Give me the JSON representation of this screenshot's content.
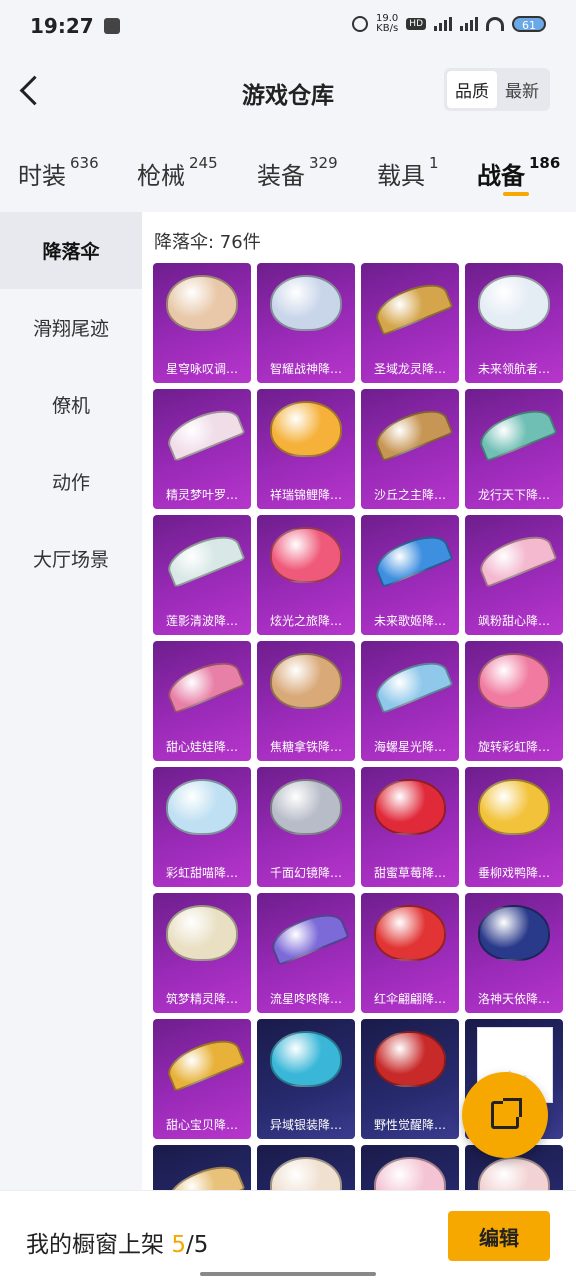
{
  "status_bar": {
    "time": "19:27",
    "speed_value": "19.0",
    "speed_unit": "KB/s",
    "battery": "61"
  },
  "header": {
    "title": "游戏仓库",
    "sort_options": [
      "品质",
      "最新"
    ],
    "active_sort": "品质"
  },
  "tabs": [
    {
      "label": "时装",
      "count": "636",
      "active": false
    },
    {
      "label": "枪械",
      "count": "245",
      "active": false
    },
    {
      "label": "装备",
      "count": "329",
      "active": false
    },
    {
      "label": "载具",
      "count": "1",
      "active": false
    },
    {
      "label": "战备",
      "count": "186",
      "active": true
    }
  ],
  "sidebar": {
    "items": [
      {
        "label": "降落伞",
        "active": true
      },
      {
        "label": "滑翔尾迹",
        "active": false
      },
      {
        "label": "僚机",
        "active": false
      },
      {
        "label": "动作",
        "active": false
      },
      {
        "label": "大厅场景",
        "active": false
      }
    ]
  },
  "content": {
    "count_label": "降落伞: 76件",
    "items": [
      {
        "name": "星穹咏叹调…",
        "shape": "dome",
        "color": "#e8c8a8"
      },
      {
        "name": "智耀战神降…",
        "shape": "dome",
        "color": "#c9d6ea"
      },
      {
        "name": "圣域龙灵降…",
        "shape": "glider",
        "color": "#d4a54a"
      },
      {
        "name": "未来领航者…",
        "shape": "dome",
        "color": "#e4ecf4"
      },
      {
        "name": "精灵梦叶罗…",
        "shape": "glider",
        "color": "#f0dde8"
      },
      {
        "name": "祥瑞锦鲤降…",
        "shape": "dome",
        "color": "#f5b13a"
      },
      {
        "name": "沙丘之主降…",
        "shape": "glider",
        "color": "#c79654"
      },
      {
        "name": "龙行天下降…",
        "shape": "glider",
        "color": "#6fbfb5"
      },
      {
        "name": "莲影清波降…",
        "shape": "glider",
        "color": "#d8e8e6"
      },
      {
        "name": "炫光之旅降…",
        "shape": "dome",
        "color": "#ef5a7a"
      },
      {
        "name": "未来歌姬降…",
        "shape": "glider",
        "color": "#3e8fe0"
      },
      {
        "name": "飒粉甜心降…",
        "shape": "glider",
        "color": "#f4b8cf"
      },
      {
        "name": "甜心娃娃降…",
        "shape": "glider",
        "color": "#e87fa6"
      },
      {
        "name": "焦糖拿铁降…",
        "shape": "dome",
        "color": "#d9a978"
      },
      {
        "name": "海螺星光降…",
        "shape": "glider",
        "color": "#8fc8ea"
      },
      {
        "name": "旋转彩虹降…",
        "shape": "dome",
        "color": "#f07aa0"
      },
      {
        "name": "彩虹甜喵降…",
        "shape": "dome",
        "color": "#bfe0f2"
      },
      {
        "name": "千面幻镜降…",
        "shape": "dome",
        "color": "#b8bcc8"
      },
      {
        "name": "甜蜜草莓降…",
        "shape": "dome",
        "color": "#e02a3a"
      },
      {
        "name": "垂柳戏鸭降…",
        "shape": "dome",
        "color": "#f2c23a"
      },
      {
        "name": "筑梦精灵降…",
        "shape": "dome",
        "color": "#e9e0c4"
      },
      {
        "name": "流星咚咚降…",
        "shape": "glider",
        "color": "#7c6ad8"
      },
      {
        "name": "红伞翩翩降…",
        "shape": "dome",
        "color": "#e23434"
      },
      {
        "name": "洛神天依降…",
        "shape": "dome",
        "color": "#2a3a8a"
      },
      {
        "name": "甜心宝贝降…",
        "shape": "glider",
        "color": "#e8b23a",
        "theme": "purple"
      },
      {
        "name": "异域银装降…",
        "shape": "dome",
        "color": "#3ab7d8",
        "theme": "dark"
      },
      {
        "name": "野性觉醒降…",
        "shape": "dome",
        "color": "#c82a2a",
        "theme": "dark"
      },
      {
        "name": "",
        "shape": "placeholder",
        "color": "#ffffff",
        "theme": "dark"
      },
      {
        "name": "",
        "shape": "glider",
        "color": "#e8c27a",
        "theme": "dark"
      },
      {
        "name": "",
        "shape": "dome",
        "color": "#f0e0d0",
        "theme": "dark"
      },
      {
        "name": "",
        "shape": "dome",
        "color": "#f4c4d4",
        "theme": "dark"
      },
      {
        "name": "",
        "shape": "dome",
        "color": "#f2d2d2",
        "theme": "dark"
      }
    ]
  },
  "bottom_bar": {
    "label_prefix": "我的橱窗上架 ",
    "shown": "5",
    "separator": "/",
    "total": "5",
    "edit_label": "编辑"
  }
}
